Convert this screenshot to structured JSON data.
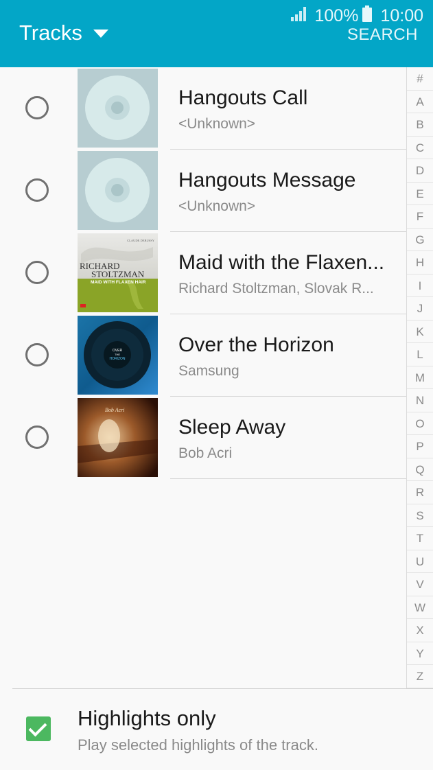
{
  "status_bar": {
    "battery_percent": "100%",
    "time": "10:00"
  },
  "header": {
    "title": "Tracks",
    "search_label": "SEARCH"
  },
  "tracks": [
    {
      "title": "Hangouts Call",
      "subtitle": "<Unknown>",
      "artwork": "cd-placeholder"
    },
    {
      "title": "Hangouts Message",
      "subtitle": "<Unknown>",
      "artwork": "cd-placeholder"
    },
    {
      "title": "Maid with the Flaxen...",
      "subtitle": "Richard Stoltzman, Slovak R...",
      "artwork": "album-cover",
      "cover_text": {
        "top": "CLAUDE DEBUSSY",
        "line1": "RICHARD",
        "line2": "STOLTZMAN",
        "band": "MAID WITH FLAXEN HAIR"
      }
    },
    {
      "title": "Over the Horizon",
      "subtitle": "Samsung",
      "artwork": "album-cover",
      "cover_text": {
        "line1": "OVER",
        "line2": "THE",
        "line3": "HORIZON"
      }
    },
    {
      "title": "Sleep Away",
      "subtitle": "Bob Acri",
      "artwork": "album-cover",
      "cover_text": {
        "line1": "Bob Acri"
      }
    }
  ],
  "index_letters": [
    "#",
    "A",
    "B",
    "C",
    "D",
    "E",
    "F",
    "G",
    "H",
    "I",
    "J",
    "K",
    "L",
    "M",
    "N",
    "O",
    "P",
    "Q",
    "R",
    "S",
    "T",
    "U",
    "V",
    "W",
    "X",
    "Y",
    "Z"
  ],
  "highlights": {
    "label": "Highlights only",
    "description": "Play selected highlights of the track.",
    "checked": true
  },
  "colors": {
    "header": "#03a6c7",
    "checkbox": "#4cb860"
  }
}
